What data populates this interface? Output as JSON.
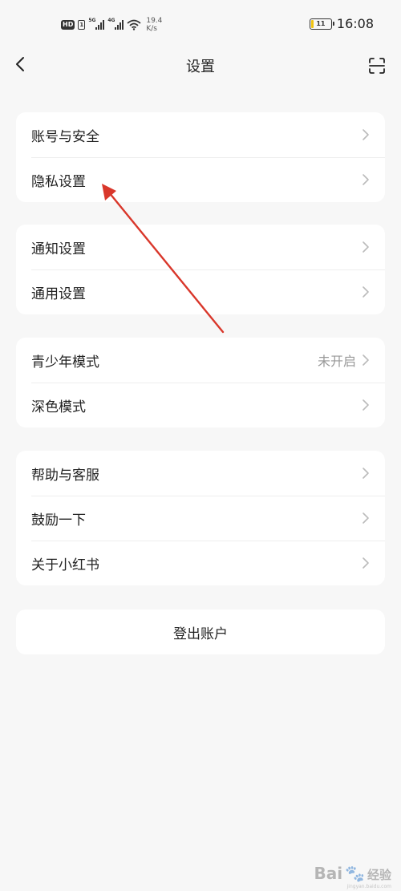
{
  "status_bar": {
    "hd": "HD",
    "sim": "1",
    "sim1_tag": "5G",
    "sim2_tag": "4G",
    "speed_value": "19.4",
    "speed_unit": "K/s",
    "battery_label": "11",
    "battery_level": 0.11,
    "battery_color": "#f1c40f",
    "time": "16:08"
  },
  "nav": {
    "title": "设置",
    "back_icon": "chevron-left-icon",
    "scan_icon": "scan-icon"
  },
  "groups": [
    {
      "items": [
        {
          "label": "账号与安全",
          "value": ""
        },
        {
          "label": "隐私设置",
          "value": ""
        }
      ]
    },
    {
      "items": [
        {
          "label": "通知设置",
          "value": ""
        },
        {
          "label": "通用设置",
          "value": ""
        }
      ]
    },
    {
      "items": [
        {
          "label": "青少年模式",
          "value": "未开启"
        },
        {
          "label": "深色模式",
          "value": ""
        }
      ]
    },
    {
      "items": [
        {
          "label": "帮助与客服",
          "value": ""
        },
        {
          "label": "鼓励一下",
          "value": ""
        },
        {
          "label": "关于小红书",
          "value": ""
        }
      ]
    }
  ],
  "logout_label": "登出账户",
  "annotation_color": "#d9372b",
  "watermark": {
    "main": "Bai",
    "after": "经验",
    "sub": "jingyan.baidu.com"
  }
}
